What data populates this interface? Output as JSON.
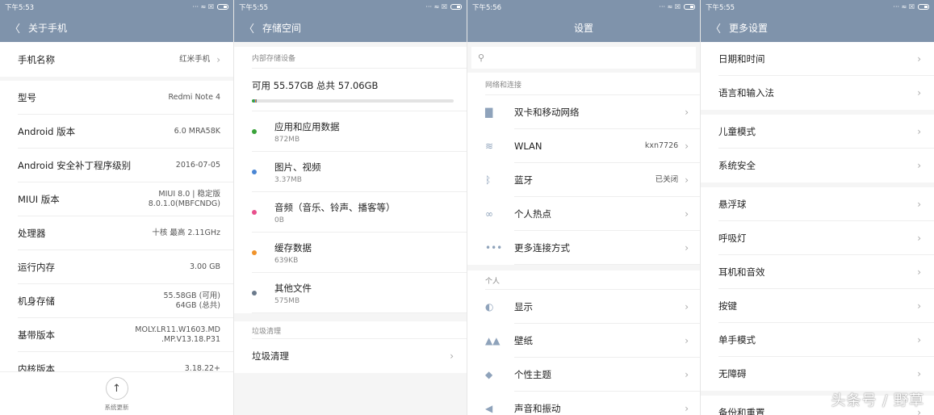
{
  "colors": {
    "header": "#7f93ab",
    "apps": "#3aa33a",
    "media": "#4a86d4",
    "audio": "#e8508c",
    "cache": "#f0932b",
    "other": "#6b7a8c"
  },
  "about": {
    "time": "下午5:53",
    "title": "关于手机",
    "name_row": {
      "label": "手机名称",
      "value": "红米手机"
    },
    "rows": [
      {
        "label": "型号",
        "value": [
          "Redmi Note 4"
        ]
      },
      {
        "label": "Android 版本",
        "value": [
          "6.0 MRA58K"
        ]
      },
      {
        "label": "Android 安全补丁程序级别",
        "value": [
          "2016-07-05"
        ]
      },
      {
        "label": "MIUI 版本",
        "value": [
          "MIUI 8.0 | 稳定版",
          "8.0.1.0(MBFCNDG)"
        ]
      },
      {
        "label": "处理器",
        "value": [
          "十核 最高 2.11GHz"
        ]
      },
      {
        "label": "运行内存",
        "value": [
          "3.00 GB"
        ]
      },
      {
        "label": "机身存储",
        "value": [
          "55.58GB (可用)",
          "64GB (总共)"
        ]
      },
      {
        "label": "基带版本",
        "value": [
          "MOLY.LR11.W1603.MD",
          ".MP.V13.18.P31"
        ]
      },
      {
        "label": "内核版本",
        "value": [
          "3.18.22+"
        ]
      }
    ],
    "update_label": "系统更新"
  },
  "storage": {
    "time": "下午5:55",
    "title": "存储空间",
    "section": "内部存储设备",
    "summary": "可用 55.57GB   总共 57.06GB",
    "used_fraction": 0.026,
    "items": [
      {
        "name": "应用和应用数据",
        "size": "872MB",
        "color": "#3aa33a"
      },
      {
        "name": "图片、视频",
        "size": "3.37MB",
        "color": "#4a86d4"
      },
      {
        "name": "音频（音乐、铃声、播客等）",
        "size": "0B",
        "color": "#e8508c"
      },
      {
        "name": "缓存数据",
        "size": "639KB",
        "color": "#f0932b"
      },
      {
        "name": "其他文件",
        "size": "575MB",
        "color": "#6b7a8c"
      }
    ],
    "clean_section": "垃圾清理",
    "clean_row": "垃圾清理"
  },
  "settings": {
    "time": "下午5:56",
    "title": "设置",
    "search_placeholder": "",
    "sections": [
      {
        "title": "网络和连接",
        "rows": [
          {
            "icon": "sim-icon",
            "glyph": "▇",
            "label": "双卡和移动网络",
            "value": ""
          },
          {
            "icon": "wifi-icon",
            "glyph": "≋",
            "label": "WLAN",
            "value": "kxn7726"
          },
          {
            "icon": "bluetooth-icon",
            "glyph": "ᛒ",
            "label": "蓝牙",
            "value": "已关闭"
          },
          {
            "icon": "hotspot-icon",
            "glyph": "∞",
            "label": "个人热点",
            "value": ""
          },
          {
            "icon": "more-icon",
            "glyph": "•••",
            "label": "更多连接方式",
            "value": ""
          }
        ]
      },
      {
        "title": "个人",
        "rows": [
          {
            "icon": "display-icon",
            "glyph": "◐",
            "label": "显示",
            "value": ""
          },
          {
            "icon": "wallpaper-icon",
            "glyph": "▲▲",
            "label": "壁纸",
            "value": ""
          },
          {
            "icon": "theme-icon",
            "glyph": "◆",
            "label": "个性主题",
            "value": ""
          },
          {
            "icon": "sound-icon",
            "glyph": "◀",
            "label": "声音和振动",
            "value": ""
          }
        ]
      }
    ]
  },
  "more": {
    "time": "下午5:55",
    "title": "更多设置",
    "groups": [
      [
        "日期和时间",
        "语言和输入法"
      ],
      [
        "儿童模式",
        "系统安全"
      ],
      [
        "悬浮球",
        "呼吸灯",
        "耳机和音效",
        "按键",
        "单手模式",
        "无障碍"
      ],
      [
        "备份和重置"
      ]
    ]
  },
  "watermark": "头条号 / 野草"
}
